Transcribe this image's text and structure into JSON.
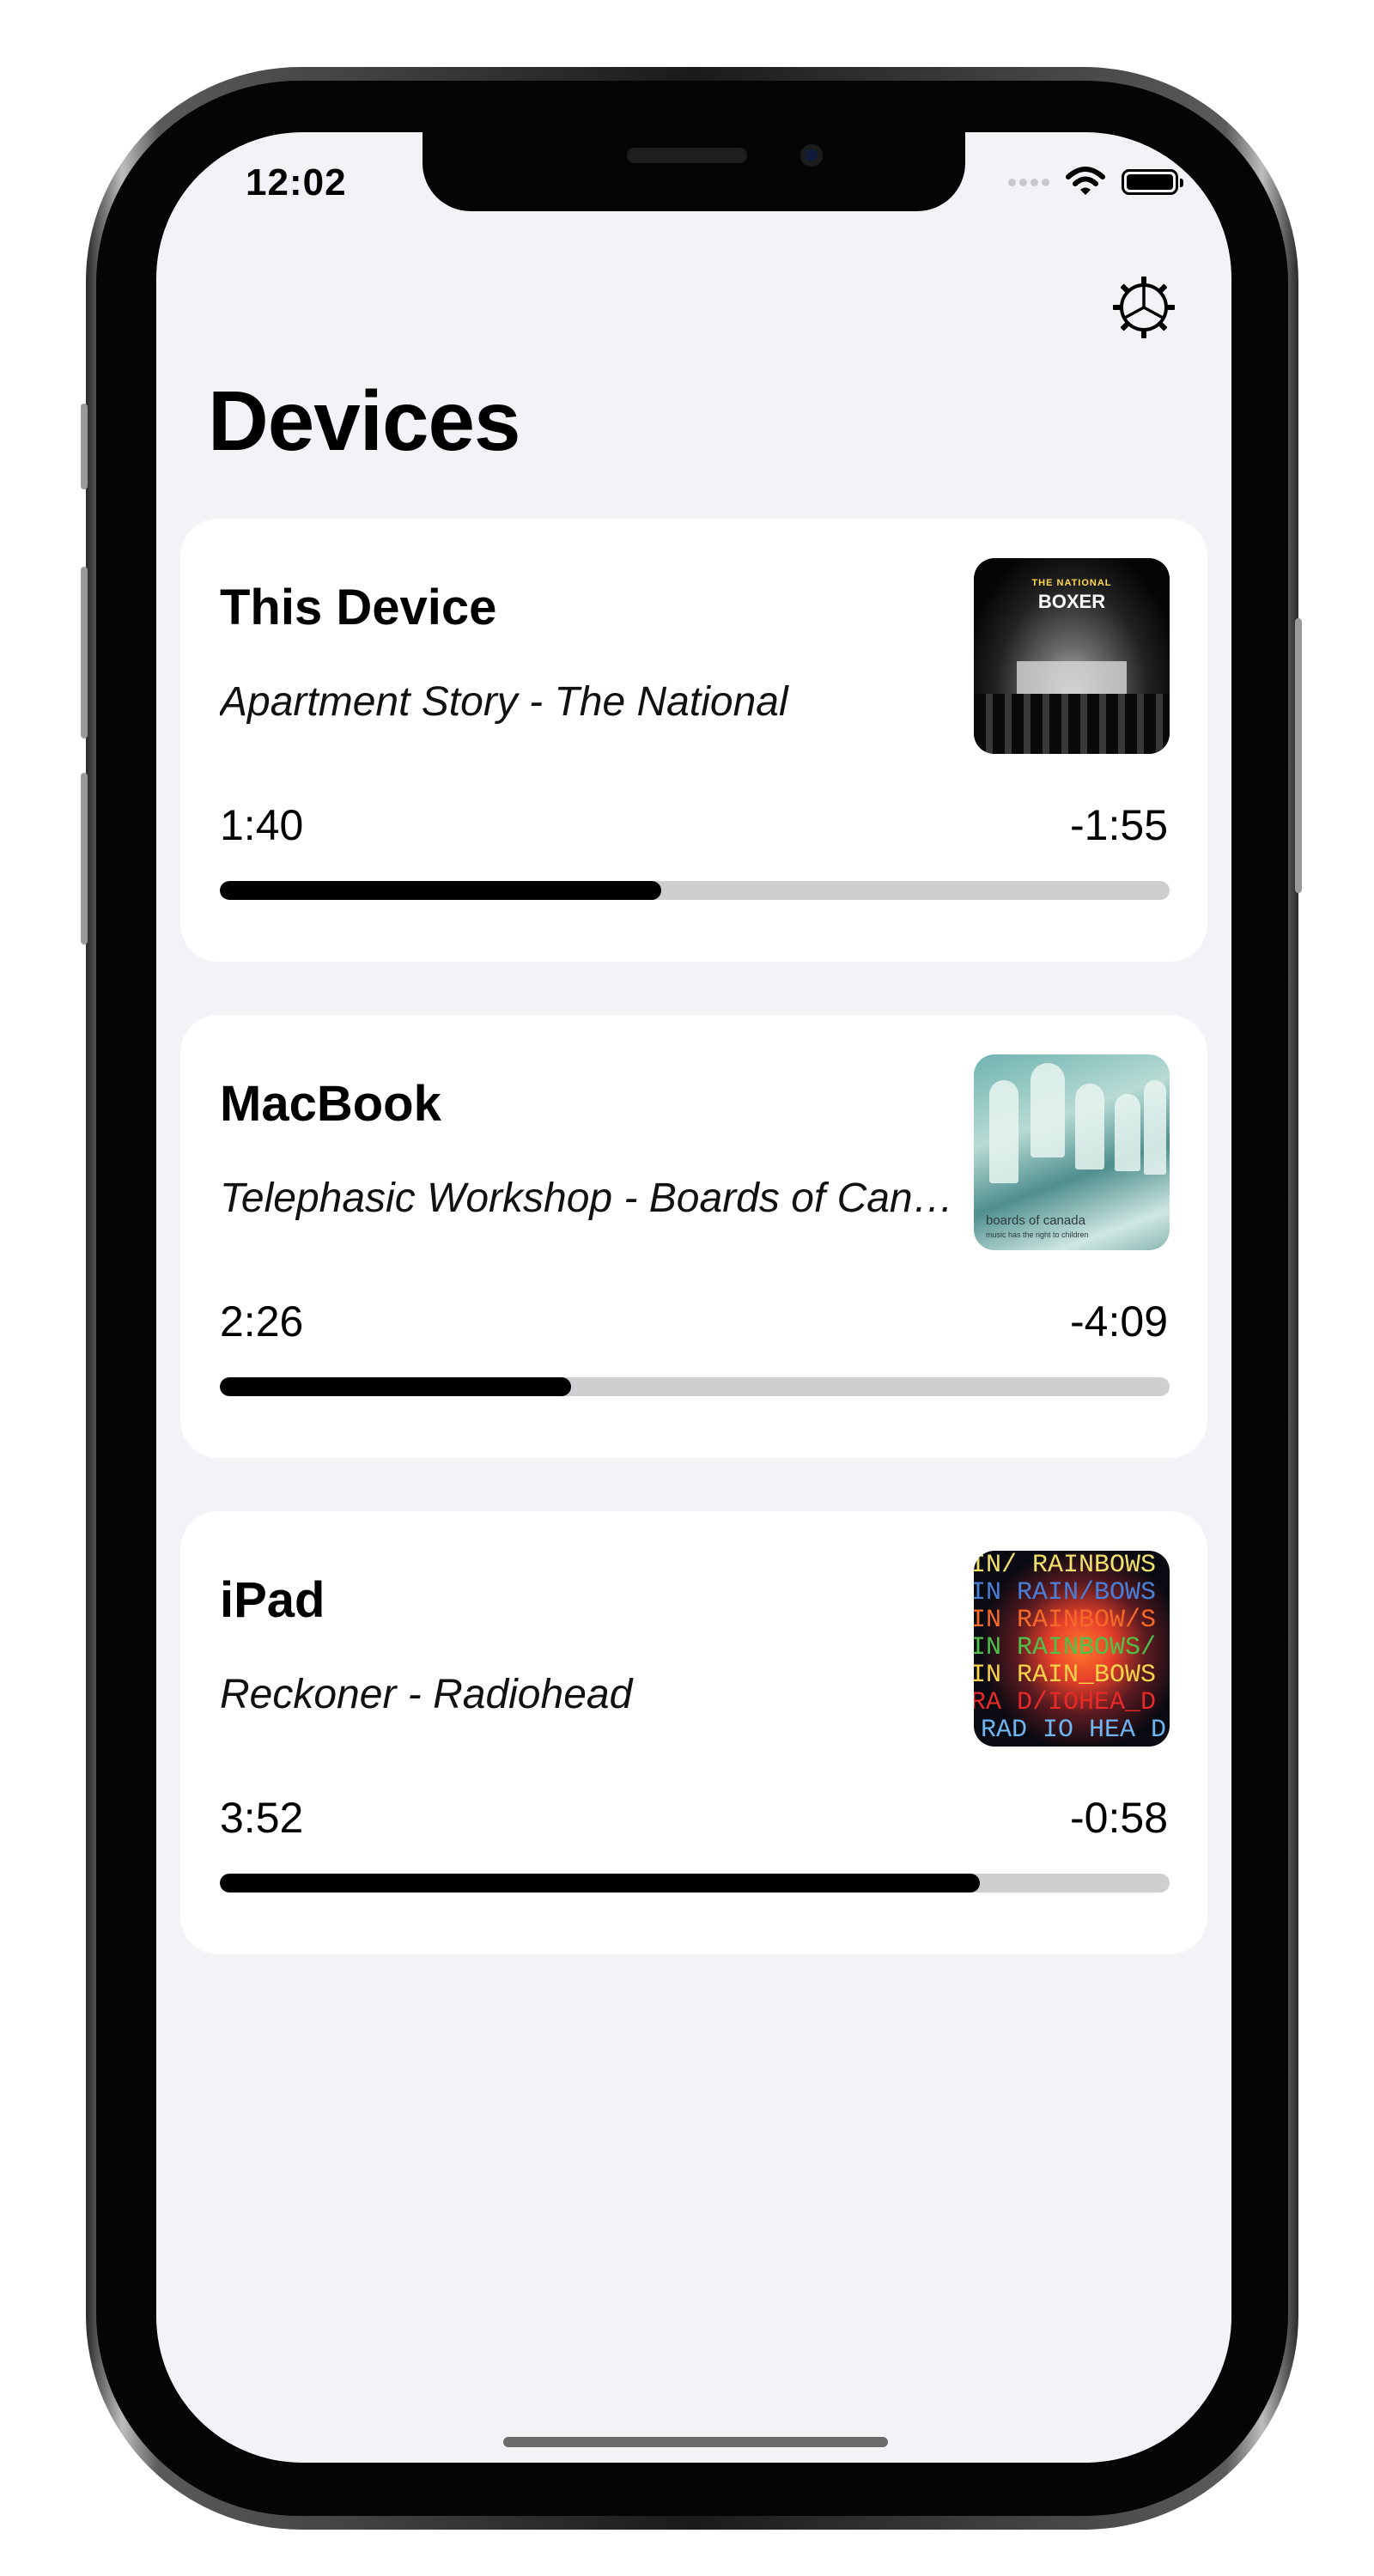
{
  "status_bar": {
    "time": "12:02"
  },
  "header": {
    "title": "Devices",
    "settings_icon": "gear-icon"
  },
  "colors": {
    "background": "#f2f2f7",
    "card": "#ffffff",
    "progress_track": "#cfcfd2",
    "progress_fill": "#000000"
  },
  "devices": [
    {
      "name": "This Device",
      "track": "Apartment Story - The National",
      "elapsed": "1:40",
      "remaining": "-1:55",
      "progress": 0.465,
      "artwork": {
        "title": "BOXER",
        "subtitle": "THE NATIONAL"
      }
    },
    {
      "name": "MacBook",
      "track": "Telephasic Workshop - Boards of Canada",
      "elapsed": "2:26",
      "remaining": "-4:09",
      "progress": 0.37,
      "artwork": {
        "title": "boards of canada",
        "subtitle": "music has the right to children"
      }
    },
    {
      "name": "iPad",
      "track": "Reckoner - Radiohead",
      "elapsed": "3:52",
      "remaining": "-0:58",
      "progress": 0.8,
      "artwork": {
        "lines": [
          "IN/ RAINBOWS",
          "IN RAIN/BOWS",
          "IN RAINBOW/S",
          "IN RAINBOWS/",
          "IN RAIN_BOWS",
          "RA D/IOHEA_D",
          "RAD IO HEA D"
        ]
      }
    }
  ]
}
